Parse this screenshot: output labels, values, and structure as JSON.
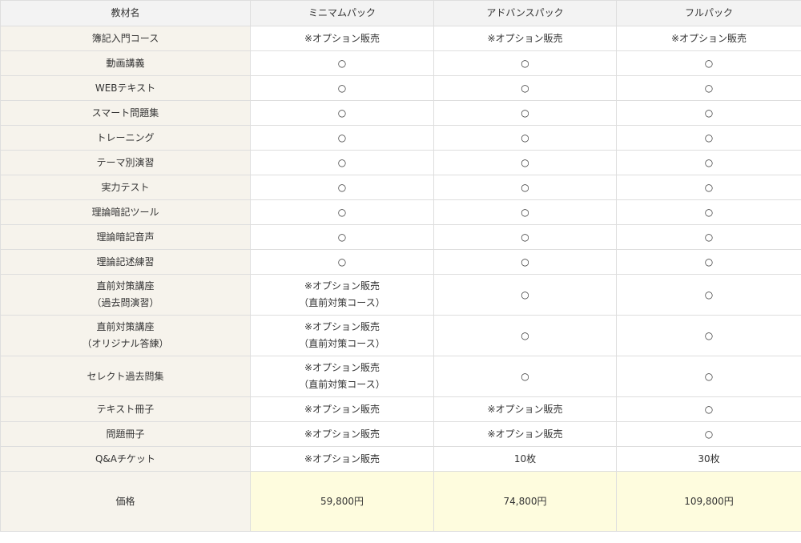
{
  "header": {
    "col0": "教材名",
    "col1": "ミニマムパック",
    "col2": "アドバンスパック",
    "col3": "フルパック"
  },
  "rows": [
    {
      "name": "簿記入門コース",
      "cells": [
        "※オプション販売",
        "※オプション販売",
        "※オプション販売"
      ]
    },
    {
      "name": "動画講義",
      "cells": [
        "○",
        "○",
        "○"
      ]
    },
    {
      "name": "WEBテキスト",
      "cells": [
        "○",
        "○",
        "○"
      ]
    },
    {
      "name": "スマート問題集",
      "cells": [
        "○",
        "○",
        "○"
      ]
    },
    {
      "name": "トレーニング",
      "cells": [
        "○",
        "○",
        "○"
      ]
    },
    {
      "name": "テーマ別演習",
      "cells": [
        "○",
        "○",
        "○"
      ]
    },
    {
      "name": "実力テスト",
      "cells": [
        "○",
        "○",
        "○"
      ]
    },
    {
      "name": "理論暗記ツール",
      "cells": [
        "○",
        "○",
        "○"
      ]
    },
    {
      "name": "理論暗記音声",
      "cells": [
        "○",
        "○",
        "○"
      ]
    },
    {
      "name": "理論記述練習",
      "cells": [
        "○",
        "○",
        "○"
      ]
    },
    {
      "name": "直前対策講座",
      "name_sub": "（過去問演習）",
      "cells": [
        "※オプション販売",
        "○",
        "○"
      ],
      "cell1_sub": "（直前対策コース）"
    },
    {
      "name": "直前対策講座",
      "name_sub": "（オリジナル答練）",
      "cells": [
        "※オプション販売",
        "○",
        "○"
      ],
      "cell1_sub": "（直前対策コース）"
    },
    {
      "name": "セレクト過去問集",
      "cells": [
        "※オプション販売",
        "○",
        "○"
      ],
      "cell1_sub": "（直前対策コース）"
    },
    {
      "name": "テキスト冊子",
      "cells": [
        "※オプション販売",
        "※オプション販売",
        "○"
      ]
    },
    {
      "name": "問題冊子",
      "cells": [
        "※オプション販売",
        "※オプション販売",
        "○"
      ]
    },
    {
      "name": "Q&Aチケット",
      "cells": [
        "※オプション販売",
        "10枚",
        "30枚"
      ]
    }
  ],
  "price": {
    "label": "価格",
    "values": [
      "59,800円",
      "74,800円",
      "109,800円"
    ]
  },
  "colors": {
    "header_bg": "#f3f3f3",
    "name_col_bg": "#f6f3ec",
    "price_bg": "#fefcde",
    "border": "#dedede"
  }
}
